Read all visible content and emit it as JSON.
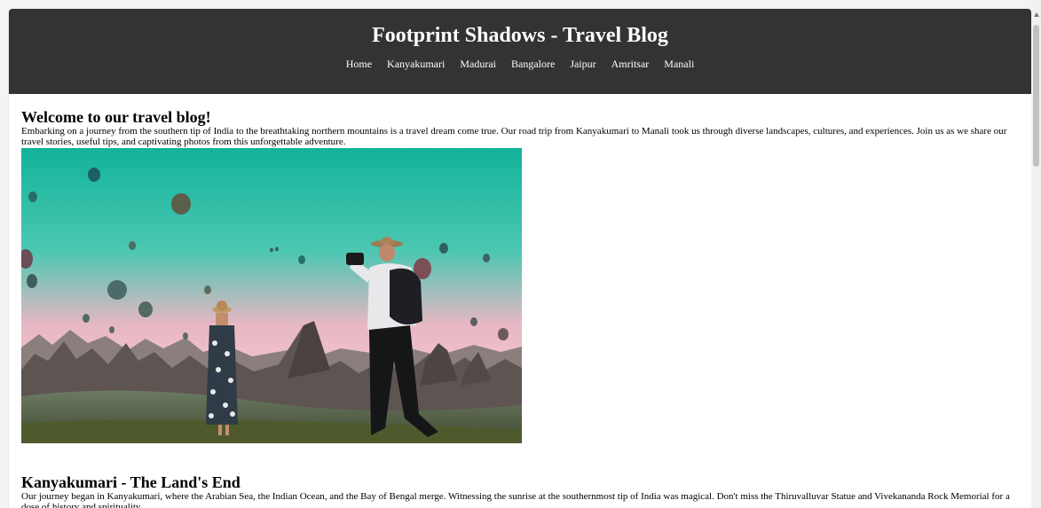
{
  "header": {
    "title": "Footprint Shadows - Travel Blog"
  },
  "nav": {
    "items": [
      "Home",
      "Kanyakumari",
      "Madurai",
      "Bangalore",
      "Jaipur",
      "Amritsar",
      "Manali"
    ]
  },
  "sections": [
    {
      "heading": "Welcome to our travel blog!",
      "text": "Embarking on a journey from the southern tip of India to the breathtaking northern mountains is a travel dream come true. Our road trip from Kanyakumari to Manali took us through diverse landscapes, cultures, and experiences. Join us as we share our travel stories, useful tips, and captivating photos from this unforgettable adventure."
    },
    {
      "heading": "Kanyakumari - The Land's End",
      "text": "Our journey began in Kanyakumari, where the Arabian Sea, the Indian Ocean, and the Bay of Bengal merge. Witnessing the sunrise at the southernmost tip of India was magical. Don't miss the Thiruvalluvar Statue and Vivekananda Rock Memorial for a dose of history and spirituality."
    }
  ],
  "colors": {
    "header_bg": "#333333",
    "header_text": "#ffffff"
  }
}
